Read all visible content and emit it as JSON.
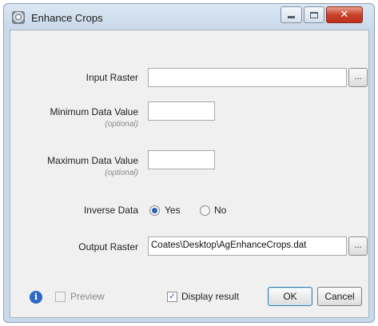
{
  "window": {
    "title": "Enhance Crops",
    "controls": {
      "minimize": "minimize-icon",
      "maximize": "maximize-icon",
      "close": "close-icon"
    }
  },
  "form": {
    "input_raster": {
      "label": "Input Raster",
      "value": "",
      "browse_label": "..."
    },
    "min_value": {
      "label": "Minimum Data Value",
      "sub": "(optional)",
      "value": ""
    },
    "max_value": {
      "label": "Maximum Data Value",
      "sub": "(optional)",
      "value": ""
    },
    "inverse": {
      "label": "Inverse Data",
      "yes": "Yes",
      "no": "No",
      "selected": "Yes"
    },
    "output_raster": {
      "label": "Output Raster",
      "value": "Coates\\Desktop\\AgEnhanceCrops.dat",
      "browse_label": "..."
    }
  },
  "footer": {
    "info_icon": "i",
    "preview_label": "Preview",
    "preview_checked": false,
    "display_result_label": "Display result",
    "display_result_checked": true,
    "ok_label": "OK",
    "cancel_label": "Cancel"
  }
}
